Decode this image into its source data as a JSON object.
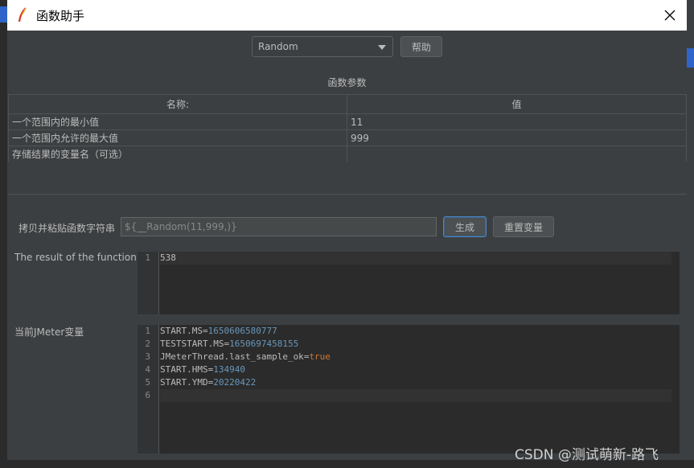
{
  "window": {
    "title": "函数助手"
  },
  "function_select": {
    "selected": "Random"
  },
  "toolbar": {
    "help_label": "帮助"
  },
  "params": {
    "section_title": "函数参数",
    "headers": [
      "名称:",
      "值"
    ],
    "rows": [
      {
        "name": "一个范围内的最小值",
        "value": "11"
      },
      {
        "name": "一个范围内允许的最大值",
        "value": "999"
      },
      {
        "name": "存储结果的变量名（可选）",
        "value": ""
      }
    ]
  },
  "copy": {
    "label": "拷贝并粘贴函数字符串",
    "value": "${__Random(11,999,)}",
    "generate_label": "生成",
    "reset_label": "重置变量"
  },
  "result": {
    "label": "The result of the function is",
    "lines": [
      {
        "ln": "1",
        "value": "538"
      }
    ]
  },
  "jmeter_vars": {
    "label": "当前JMeter变量",
    "lines": [
      {
        "ln": "1",
        "key": "START.MS",
        "value": "1650606580777"
      },
      {
        "ln": "2",
        "key": "TESTSTART.MS",
        "value": "1650697458155"
      },
      {
        "ln": "3",
        "key": "JMeterThread.last_sample_ok",
        "value": "true"
      },
      {
        "ln": "4",
        "key": "START.HMS",
        "value": "134940"
      },
      {
        "ln": "5",
        "key": "START.YMD",
        "value": "20220422"
      },
      {
        "ln": "6",
        "key": "",
        "value": ""
      }
    ]
  },
  "watermark": "CSDN @测试萌新-路飞",
  "colors": {
    "panel": "#3c3f41",
    "editor": "#2b2b2b",
    "number": "#6897bb",
    "keyword": "#cc7832"
  }
}
